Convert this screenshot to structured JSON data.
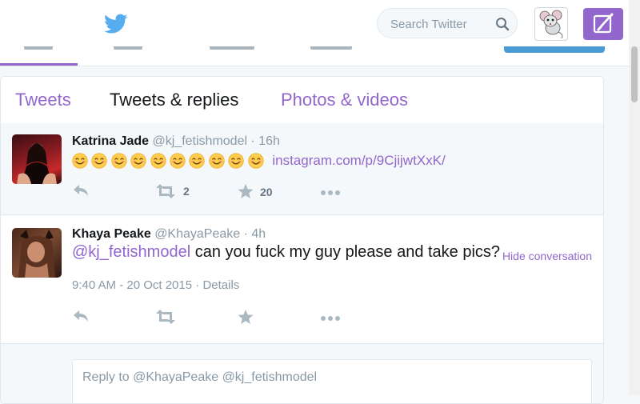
{
  "search": {
    "placeholder": "Search Twitter"
  },
  "tabs": [
    {
      "label": "Tweets"
    },
    {
      "label": "Tweets & replies"
    },
    {
      "label": "Photos & videos"
    }
  ],
  "tweets": [
    {
      "name": "Katrina Jade",
      "handle": "@kj_fetishmodel",
      "dot": "·",
      "time": "16h",
      "emoji_count": 10,
      "link": "instagram.com/p/9CjijwtXxK/",
      "retweets": "2",
      "favorites": "20"
    },
    {
      "name": "Khaya Peake",
      "handle": "@KhayaPeake",
      "dot": "·",
      "time": "4h",
      "mention": "@kj_fetishmodel",
      "text": " can you fuck my guy please and take pics?",
      "datetime": "9:40 AM - 20 Oct 2015",
      "meta_sep": " · ",
      "details": "Details",
      "hide_conversation": "Hide conversation"
    }
  ],
  "reply": {
    "placeholder": "Reply to @KhayaPeake @kj_fetishmodel"
  },
  "colors": {
    "accent": "#9266cc",
    "twitter_blue": "#55acee",
    "muted": "#8899a6"
  }
}
